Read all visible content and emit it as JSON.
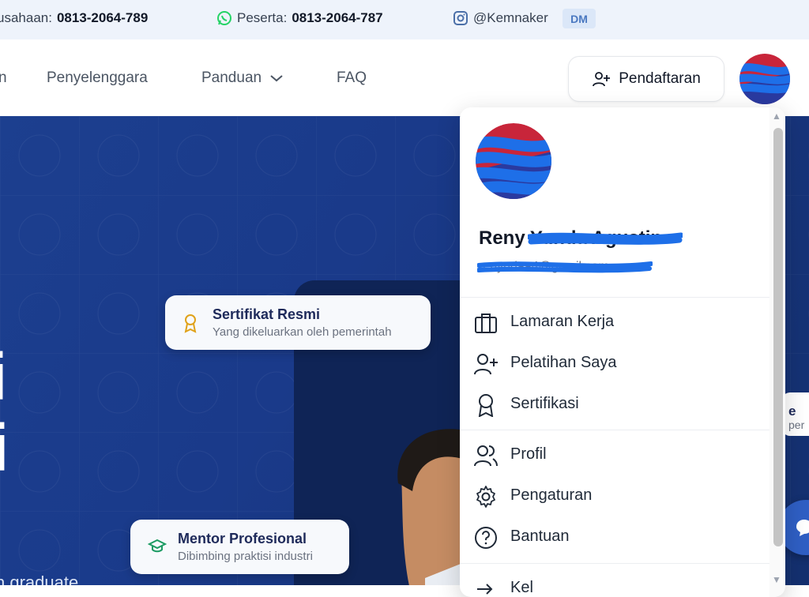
{
  "topbar": {
    "company_phone": {
      "prefix": "usahaan:",
      "number": "0813-2064-789"
    },
    "participant_phone": {
      "prefix": "Peserta:",
      "number": "0813-2064-787"
    },
    "instagram": "@Kemnaker",
    "dm_badge": "DM"
  },
  "nav": {
    "partial_left": "n",
    "links": [
      "Penyelenggara",
      "Panduan",
      "FAQ"
    ],
    "register_label": "Pendaftaran"
  },
  "hero": {
    "cards": [
      {
        "title": "Sertifikat Resmi",
        "subtitle": "Yang dikeluarkan oleh pemerintah"
      },
      {
        "title": "Mentor Profesional",
        "subtitle": "Dibimbing praktisi industri"
      }
    ],
    "partial_card": {
      "title": "e",
      "subtitle": "per"
    },
    "subtitle_partial": "h graduate",
    "glyph_1": "i",
    "glyph_2": "i"
  },
  "user_menu": {
    "name": "Reny Yunda Agustin",
    "email": "renyndaa4@gmail.com",
    "items_group1": [
      "Lamaran Kerja",
      "Pelatihan Saya",
      "Sertifikasi"
    ],
    "items_group2": [
      "Profil",
      "Pengaturan",
      "Bantuan"
    ],
    "logout_partial": "Kel"
  },
  "colors": {
    "hero_blue": "#1c3f8f",
    "accent": "#2f5fc4",
    "whatsapp_green": "#25d366",
    "redaction_blue": "#1e6fe8"
  }
}
